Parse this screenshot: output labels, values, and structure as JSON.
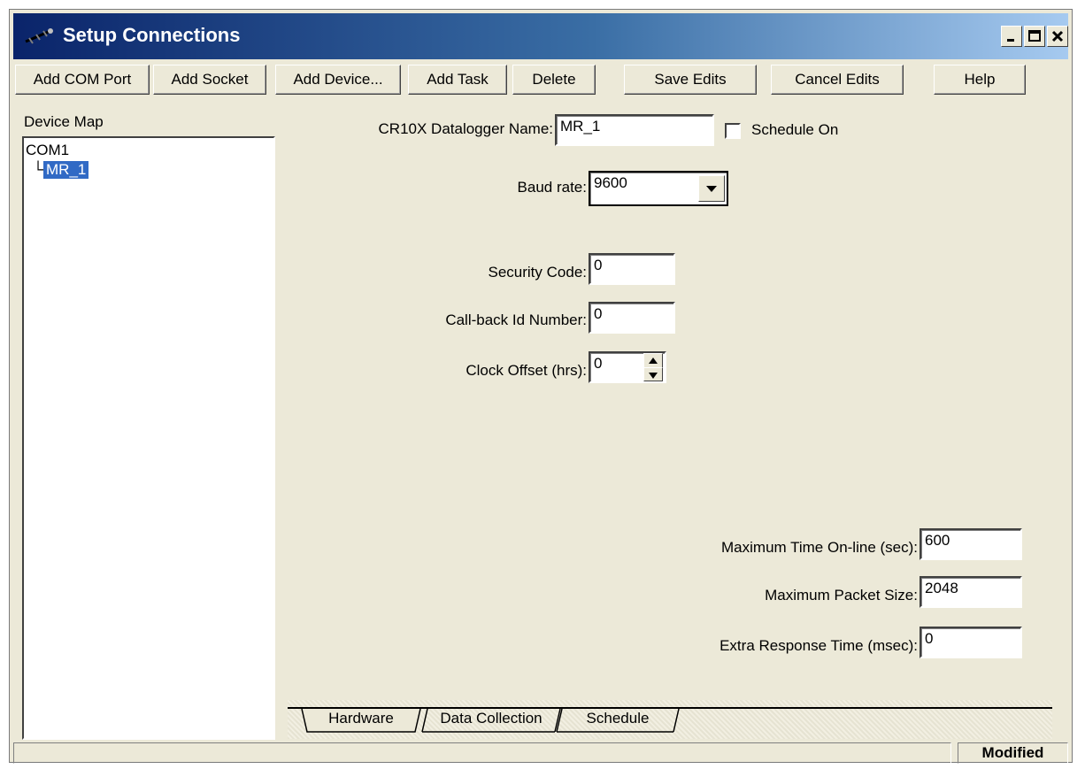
{
  "window": {
    "title": "Setup Connections",
    "app_icon": "connection-icon",
    "controls": [
      "minimize-icon",
      "maximize-icon",
      "close-icon"
    ]
  },
  "toolbar": {
    "add_com_port": "Add COM Port",
    "add_socket": "Add Socket",
    "add_device": "Add Device...",
    "add_task": "Add Task",
    "delete": "Delete",
    "save_edits": "Save Edits",
    "cancel_edits": "Cancel Edits",
    "help": "Help"
  },
  "device_map": {
    "label": "Device Map",
    "root": "COM1",
    "branch_glyph": "└",
    "child": "MR_1"
  },
  "form": {
    "name_label": "CR10X Datalogger Name:",
    "name_value": "MR_1",
    "schedule_label": "Schedule On",
    "schedule_checked": false,
    "baud_label": "Baud rate:",
    "baud_value": "9600",
    "security_label": "Security Code:",
    "security_value": "0",
    "callback_label": "Call-back Id Number:",
    "callback_value": "0",
    "clock_label": "Clock Offset (hrs):",
    "clock_value": "0",
    "max_time_label": "Maximum Time On-line (sec):",
    "max_time_value": "600",
    "max_packet_label": "Maximum Packet Size:",
    "max_packet_value": "2048",
    "extra_resp_label": "Extra Response Time (msec):",
    "extra_resp_value": "0"
  },
  "tabs": [
    "Hardware",
    "Data Collection",
    "Schedule"
  ],
  "status": {
    "state": "Modified"
  },
  "colors": {
    "face": "#ece9d8",
    "title_start": "#0a246a",
    "title_end": "#a6caf0",
    "selection": "#316ac5"
  }
}
